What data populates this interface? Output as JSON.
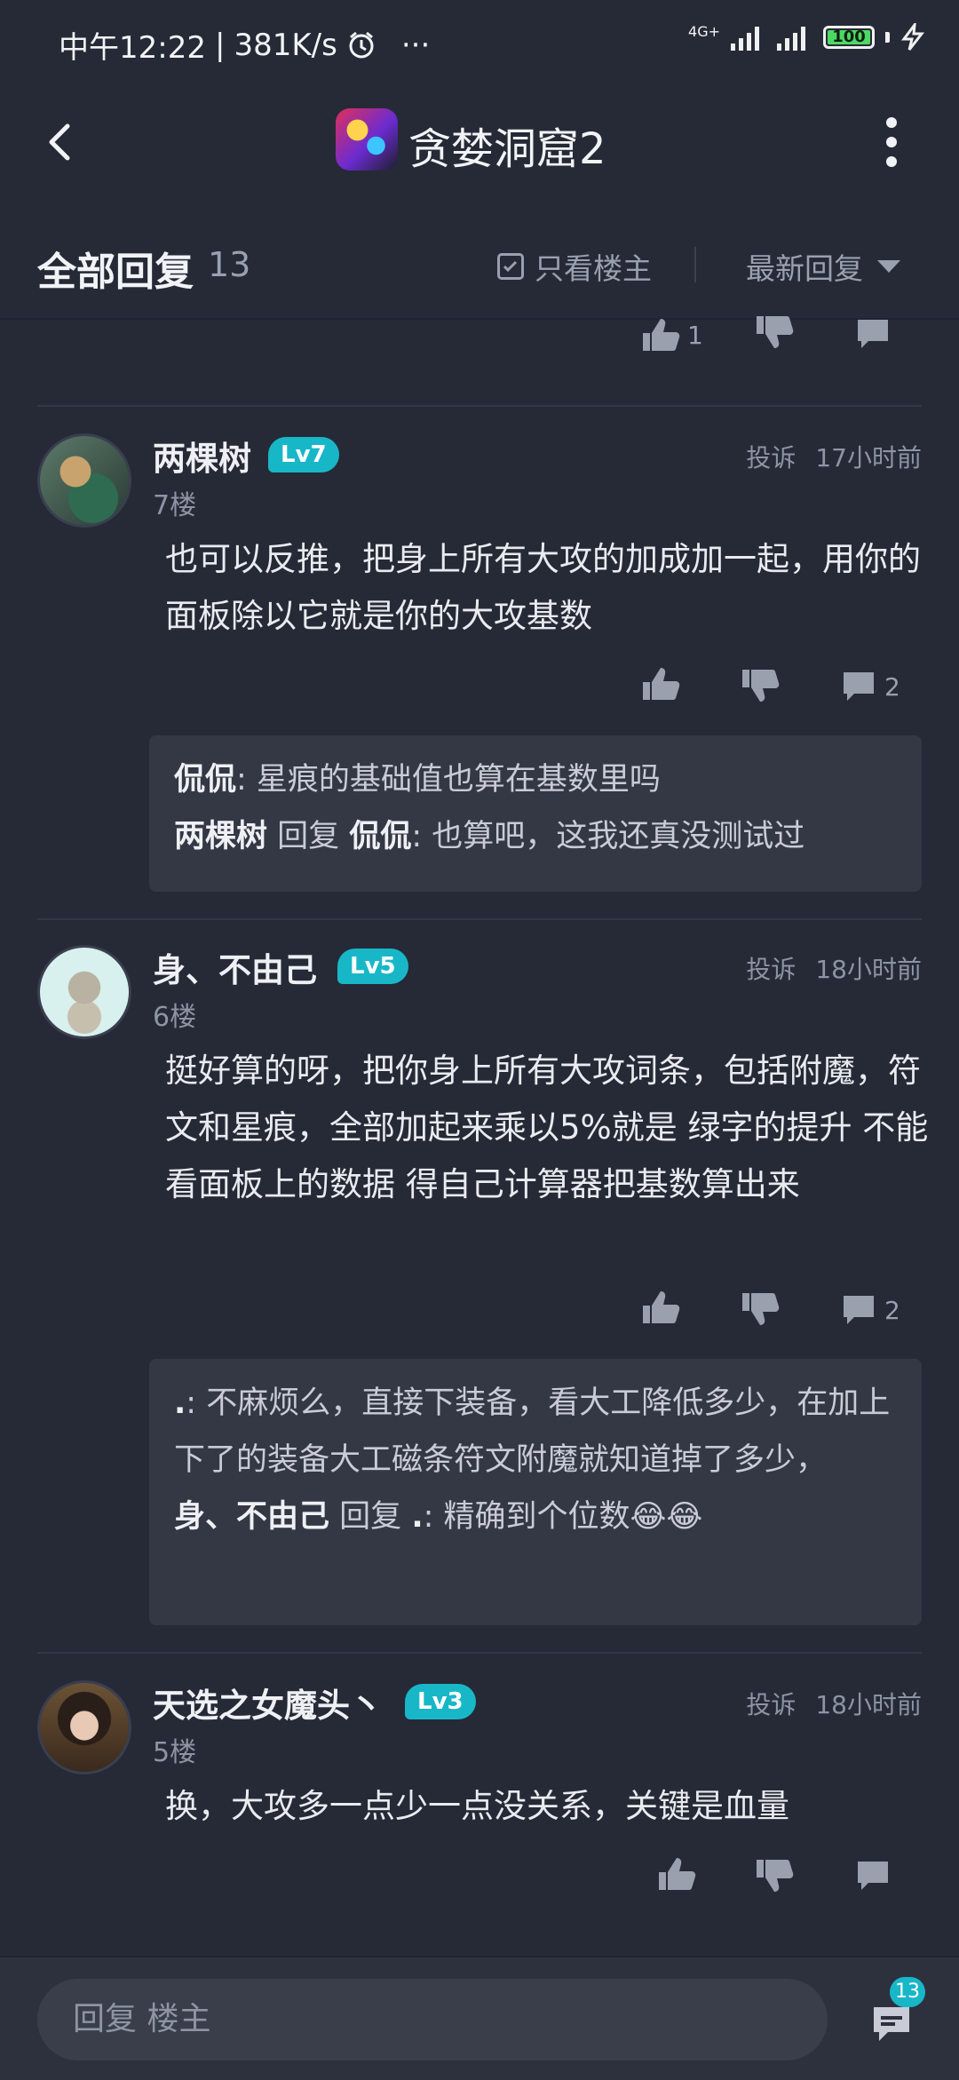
{
  "status_bar": {
    "time": "中午12:22",
    "speed": "381K/s",
    "dots": "···",
    "network": "4G+",
    "battery": "100"
  },
  "header": {
    "title": "贪婪洞窟2"
  },
  "replies_header": {
    "title": "全部回复",
    "count": "13",
    "owner_only_label": "只看楼主",
    "sort_label": "最新回复"
  },
  "partial_prev": {
    "like_count": "1"
  },
  "comments": [
    {
      "username": "两棵树",
      "level": "Lv7",
      "floor": "7楼",
      "report": "投诉",
      "time": "17小时前",
      "text": "也可以反推，把身上所有大攻的加成加一起，用你的面板除以它就是你的大攻基数",
      "reply_count": "2",
      "replies": [
        {
          "author": "侃侃",
          "text": ": 星痕的基础值也算在基数里吗"
        },
        {
          "author": "两棵树",
          "verb": "回复",
          "target": "侃侃",
          "text": ": 也算吧，这我还真没测试过"
        }
      ]
    },
    {
      "username": "身、不由己",
      "level": "Lv5",
      "floor": "6楼",
      "report": "投诉",
      "time": "18小时前",
      "text": "挺好算的呀，把你身上所有大攻词条，包括附魔，符文和星痕，全部加起来乘以5%就是 绿字的提升  不能看面板上的数据 得自己计算器把基数算出来",
      "reply_count": "2",
      "replies": [
        {
          "author": ".",
          "text": ": 不麻烦么，直接下装备，看大工降低多少，在加上下了的装备大工磁条符文附魔就知道掉了多少，"
        },
        {
          "author": "身、不由己",
          "verb": "回复",
          "target": ".",
          "text": ": 精确到个位数😂😂"
        }
      ]
    },
    {
      "username": "天选之女魔头丶",
      "level": "Lv3",
      "floor": "5楼",
      "report": "投诉",
      "time": "18小时前",
      "text": "换，大攻多一点少一点没关系，关键是血量"
    }
  ],
  "bottom_bar": {
    "input_placeholder": "回复  楼主",
    "comment_count": "13"
  },
  "colors": {
    "background": "#262a36",
    "accent": "#18b7c8"
  }
}
